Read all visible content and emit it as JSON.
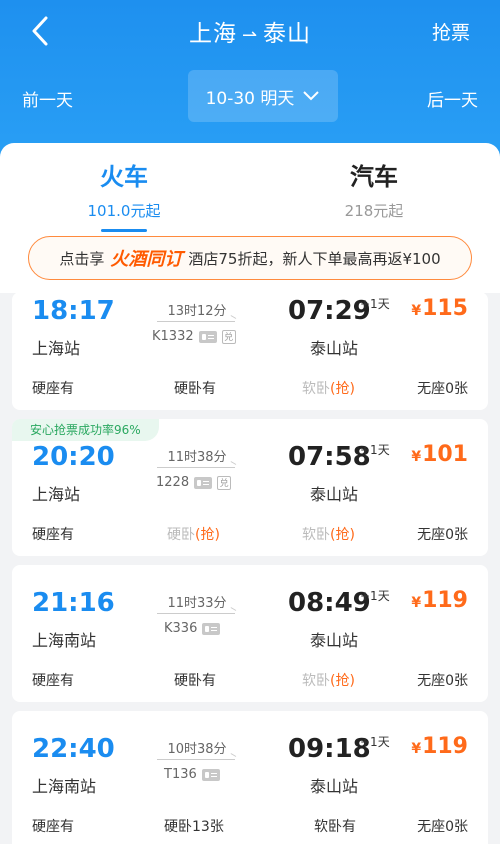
{
  "header": {
    "from": "上海",
    "to": "泰山",
    "grab_label": "抢票",
    "prev_day": "前一天",
    "next_day": "后一天",
    "date_label": "10-30 明天",
    "bg_color": "#1e90ef"
  },
  "tabs": [
    {
      "name": "火车",
      "price": "101.0元起",
      "active": true
    },
    {
      "name": "汽车",
      "price": "218元起",
      "active": false
    }
  ],
  "promo": {
    "prefix": "点击享",
    "brand": "火酒同订",
    "text": "酒店75折起，新人下单最高再返¥100"
  },
  "badge": "安心抢票成功率96%",
  "trains": [
    {
      "dep_time": "18:17",
      "dep_station": "上海站",
      "duration": "13时12分",
      "train_no": "K1332",
      "arr_time": "07:29",
      "plus_day": "+1天",
      "arr_station": "泰山站",
      "yen": "¥",
      "price": "115",
      "seats": [
        {
          "label": "硬座有"
        },
        {
          "label": "硬卧有"
        },
        {
          "label": "软卧",
          "grab": "(抢)"
        },
        {
          "label": "无座0张"
        }
      ]
    },
    {
      "dep_time": "20:20",
      "dep_station": "上海站",
      "duration": "11时38分",
      "train_no": "1228",
      "arr_time": "07:58",
      "plus_day": "+1天",
      "arr_station": "泰山站",
      "yen": "¥",
      "price": "101",
      "seats": [
        {
          "label": "硬座有"
        },
        {
          "label": "硬卧",
          "grab": "(抢)"
        },
        {
          "label": "软卧",
          "grab": "(抢)"
        },
        {
          "label": "无座0张"
        }
      ]
    },
    {
      "dep_time": "21:16",
      "dep_station": "上海南站",
      "duration": "11时33分",
      "train_no": "K336",
      "arr_time": "08:49",
      "plus_day": "+1天",
      "arr_station": "泰山站",
      "yen": "¥",
      "price": "119",
      "seats": [
        {
          "label": "硬座有"
        },
        {
          "label": "硬卧有"
        },
        {
          "label": "软卧",
          "grab": "(抢)"
        },
        {
          "label": "无座0张"
        }
      ]
    },
    {
      "dep_time": "22:40",
      "dep_station": "上海南站",
      "duration": "10时38分",
      "train_no": "T136",
      "arr_time": "09:18",
      "plus_day": "+1天",
      "arr_station": "泰山站",
      "yen": "¥",
      "price": "119",
      "seats": [
        {
          "label": "硬座有"
        },
        {
          "label": "硬卧13张"
        },
        {
          "label": "软卧有"
        },
        {
          "label": "无座0张"
        }
      ]
    }
  ],
  "colors": {
    "accent": "#1a8cf0",
    "price": "#ff6a1a",
    "grab": "#ff6a1a",
    "badge": "#2aa860"
  }
}
